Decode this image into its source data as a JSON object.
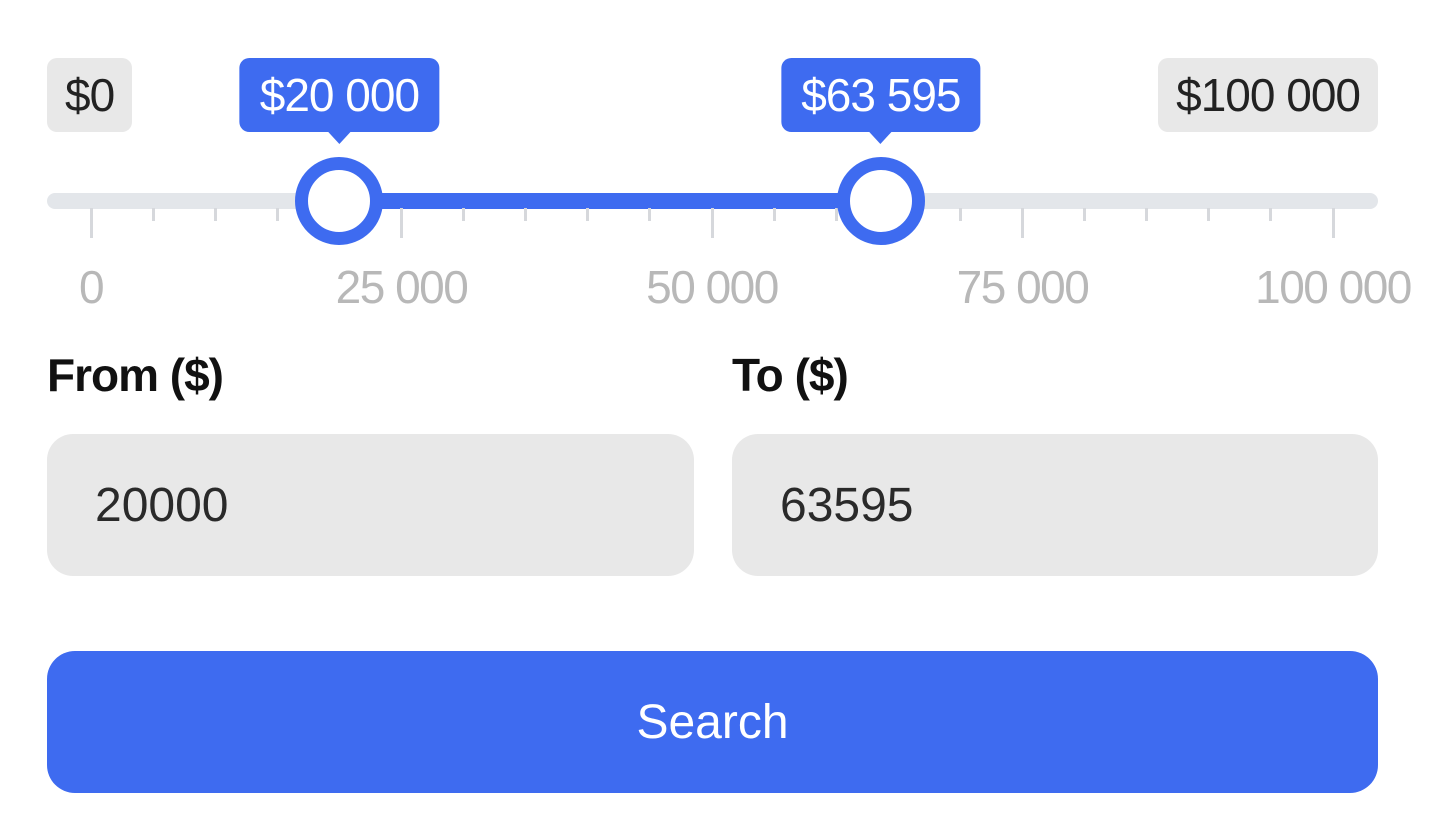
{
  "slider": {
    "min_label": "$0",
    "max_label": "$100 000",
    "range_min": 0,
    "range_max": 100000,
    "low_value": 20000,
    "high_value": 63595,
    "low_bubble": "$20 000",
    "high_bubble": "$63 595",
    "tick_labels": [
      "0",
      "25 000",
      "50 000",
      "75 000",
      "100 000"
    ],
    "accent_color": "#3e6bf0",
    "track_color": "#e3e6ea"
  },
  "fields": {
    "from_label": "From ($)",
    "to_label": "To ($)",
    "from_value": "20000",
    "to_value": "63595"
  },
  "search_button": {
    "label": "Search"
  }
}
